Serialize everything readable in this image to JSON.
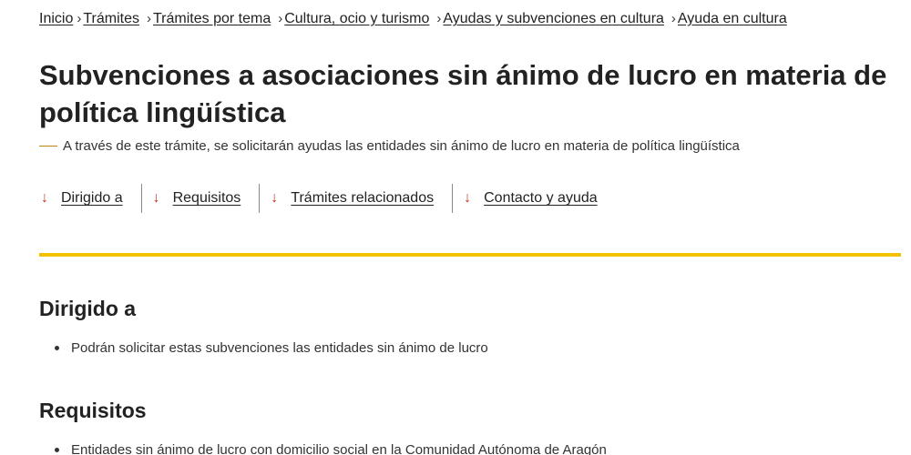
{
  "breadcrumb": [
    {
      "label": "Inicio"
    },
    {
      "label": "Trámites"
    },
    {
      "label": "Trámites por tema"
    },
    {
      "label": "Cultura, ocio y turismo"
    },
    {
      "label": "Ayudas y subvenciones en cultura"
    },
    {
      "label": "Ayuda en cultura"
    }
  ],
  "page": {
    "title": "Subvenciones a asociaciones sin ánimo de lucro en materia de política lingüística",
    "subtitle": "A través de este trámite, se solicitarán ayudas las entidades sin ánimo de lucro en materia de política lingüística"
  },
  "anchors": [
    {
      "label": "Dirigido a"
    },
    {
      "label": "Requisitos"
    },
    {
      "label": "Trámites relacionados"
    },
    {
      "label": "Contacto y ayuda"
    }
  ],
  "sections": {
    "dirigido": {
      "title": "Dirigido a",
      "items": [
        "Podrán solicitar estas subvenciones las entidades sin ánimo de lucro"
      ]
    },
    "requisitos": {
      "title": "Requisitos",
      "items": [
        "Entidades sin ánimo de lucro con domicilio social en la Comunidad Autónoma de Aragón"
      ]
    }
  },
  "colors": {
    "accent_rule": "#f2c200",
    "arrow": "#c0392b",
    "text": "#222222"
  },
  "icons": {
    "breadcrumb_separator": "chevron-right-icon",
    "anchor_arrow": "arrow-down-icon"
  }
}
